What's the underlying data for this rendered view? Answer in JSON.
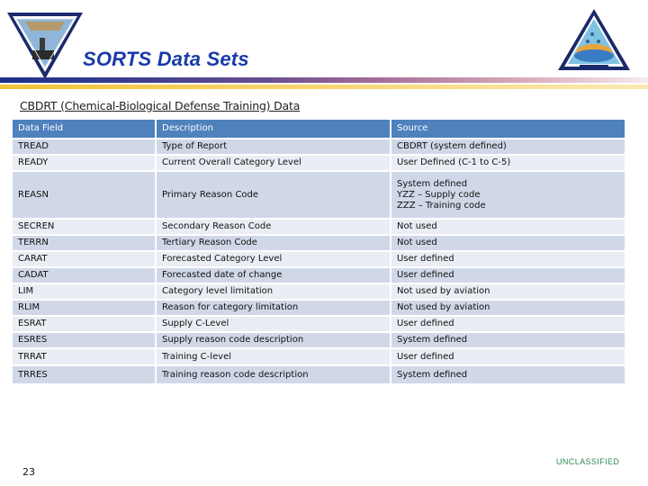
{
  "slide": {
    "title": "SORTS Data Sets",
    "subtitle": "CBDRT (Chemical-Biological Defense Training) Data",
    "page_number": "23",
    "classification": "UNCLASSIFIED"
  },
  "logos": {
    "left": "command-emblem-triangle-inverted",
    "right": "command-emblem-triangle"
  },
  "colors": {
    "title": "#1a3aa8",
    "header_fill": "#4f81bd",
    "row_dark": "#d0d8e8",
    "row_light": "#e9edf4",
    "classification": "#2e8b57"
  },
  "table": {
    "headers": [
      "Data Field",
      "Description",
      "Source"
    ],
    "rows": [
      {
        "field": "TREAD",
        "description": "Type of Report",
        "source": "CBDRT (system defined)"
      },
      {
        "field": "READY",
        "description": "Current Overall Category Level",
        "source": "User Defined (C-1 to C-5)"
      },
      {
        "field": "REASN",
        "description": "Primary Reason Code",
        "source": "System defined\nYZZ – Supply code\nZZZ – Training code"
      },
      {
        "field": "SECREN",
        "description": "Secondary Reason Code",
        "source": "Not used"
      },
      {
        "field": "TERRN",
        "description": "Tertiary Reason Code",
        "source": "Not used"
      },
      {
        "field": "CARAT",
        "description": "Forecasted Category  Level",
        "source": "User defined"
      },
      {
        "field": "CADAT",
        "description": "Forecasted date of change",
        "source": "User defined"
      },
      {
        "field": "LIM",
        "description": "Category level limitation",
        "source": "Not used by aviation"
      },
      {
        "field": "RLIM",
        "description": "Reason for category limitation",
        "source": "Not used by aviation"
      },
      {
        "field": "ESRAT",
        "description": "Supply C-Level",
        "source": "User defined"
      },
      {
        "field": "ESRES",
        "description": "Supply reason code description",
        "source": "System defined"
      },
      {
        "field": "TRRAT",
        "description": "Training C-level",
        "source": "User defined"
      },
      {
        "field": "TRRES",
        "description": "Training  reason code description",
        "source": "System defined"
      }
    ]
  }
}
